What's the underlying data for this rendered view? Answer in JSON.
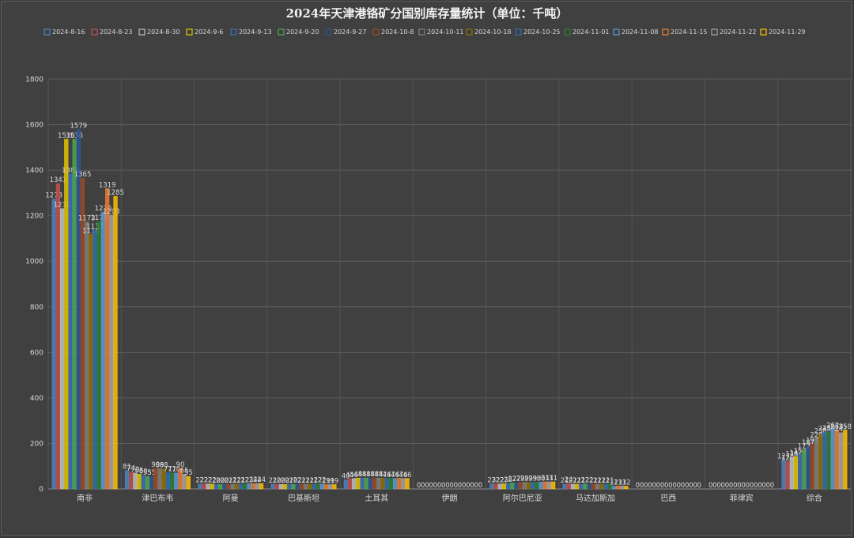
{
  "chart_data": {
    "type": "bar",
    "title": "2024年天津港铬矿分国别库存量统计（单位：千吨）",
    "xlabel": "",
    "ylabel": "",
    "ylim": [
      0,
      1800
    ],
    "yticks": [
      0,
      200,
      400,
      600,
      800,
      1000,
      1200,
      1400,
      1600,
      1800
    ],
    "grid": true,
    "legend_position": "top",
    "categories": [
      "南非",
      "津巴布韦",
      "阿曼",
      "巴基斯坦",
      "土耳其",
      "伊朗",
      "阿尔巴尼亚",
      "马达加斯加",
      "巴西",
      "菲律宾",
      "综合"
    ],
    "colors": [
      "#4f81bd",
      "#c0504d",
      "#bfbfbf",
      "#e3c400",
      "#3d6fb8",
      "#4fa84f",
      "#2f5597",
      "#9e4a1f",
      "#7f7f7f",
      "#8f7000",
      "#2f6fb3",
      "#2e7d32",
      "#5b9bd5",
      "#ed7d31",
      "#a5a5a5",
      "#ffc000"
    ],
    "series": [
      {
        "name": "2024-8-16",
        "values": [
          1273,
          81,
          22,
          21,
          40,
          0,
          23,
          21,
          0,
          0,
          127
        ]
      },
      {
        "name": "2024-8-23",
        "values": [
          1341,
          74,
          22,
          20,
          45,
          0,
          22,
          24,
          0,
          0,
          120
        ]
      },
      {
        "name": "2024-8-30",
        "values": [
          1231,
          70,
          22,
          20,
          46,
          0,
          22,
          21,
          0,
          0,
          138
        ]
      },
      {
        "name": "2024-9-6",
        "values": [
          1536,
          65,
          22,
          20,
          48,
          0,
          23,
          21,
          0,
          0,
          142
        ]
      },
      {
        "name": "2024-9-13",
        "values": [
          1383,
          60,
          20,
          21,
          48,
          0,
          25,
          21,
          0,
          0,
          152
        ]
      },
      {
        "name": "2024-9-20",
        "values": [
          1536,
          55,
          20,
          20,
          48,
          0,
          27,
          22,
          0,
          0,
          172
        ]
      },
      {
        "name": "2024-9-27",
        "values": [
          1579,
          55,
          20,
          22,
          48,
          0,
          27,
          22,
          0,
          0,
          187
        ]
      },
      {
        "name": "2024-10-8",
        "values": [
          1365,
          90,
          21,
          21,
          48,
          0,
          29,
          21,
          0,
          0,
          197
        ]
      },
      {
        "name": "2024-10-11",
        "values": [
          1173,
          89,
          21,
          21,
          48,
          0,
          29,
          21,
          0,
          0,
          220
        ]
      },
      {
        "name": "2024-10-18",
        "values": [
          1118,
          88,
          22,
          21,
          47,
          0,
          29,
          21,
          0,
          0,
          238
        ]
      },
      {
        "name": "2024-10-25",
        "values": [
          1137,
          71,
          21,
          21,
          46,
          0,
          29,
          21,
          0,
          0,
          248
        ]
      },
      {
        "name": "2024-11-01",
        "values": [
          1175,
          71,
          22,
          22,
          47,
          0,
          30,
          21,
          0,
          0,
          250
        ]
      },
      {
        "name": "2024-11-08",
        "values": [
          1216,
          70,
          23,
          22,
          46,
          0,
          30,
          12,
          0,
          0,
          262
        ]
      },
      {
        "name": "2024-11-15",
        "values": [
          1319,
          90,
          24,
          19,
          47,
          0,
          31,
          13,
          0,
          0,
          258
        ]
      },
      {
        "name": "2024-11-22",
        "values": [
          1203,
          65,
          24,
          19,
          46,
          0,
          31,
          13,
          0,
          0,
          247
        ]
      },
      {
        "name": "2024-11-29",
        "values": [
          1285,
          55,
          24,
          19,
          46,
          0,
          31,
          12,
          0,
          0,
          258
        ]
      }
    ]
  }
}
